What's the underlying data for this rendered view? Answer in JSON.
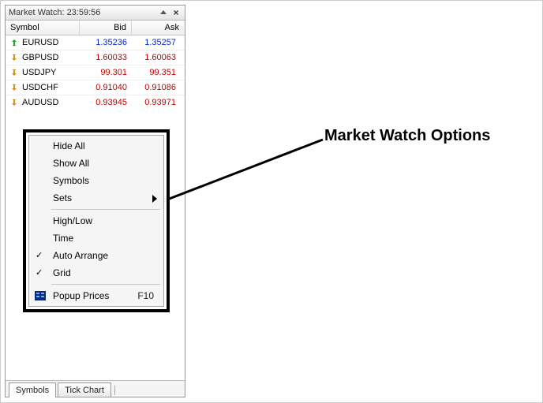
{
  "window": {
    "title_prefix": "Market Watch:",
    "time": "23:59:56"
  },
  "columns": {
    "symbol": "Symbol",
    "bid": "Bid",
    "ask": "Ask"
  },
  "rows": [
    {
      "dir": "up",
      "symbol": "EURUSD",
      "bid": "1.35236",
      "ask": "1.35257",
      "cls": "up"
    },
    {
      "dir": "down",
      "symbol": "GBPUSD",
      "bid": "1.60033",
      "ask": "1.60063",
      "cls": "down"
    },
    {
      "dir": "down",
      "symbol": "USDJPY",
      "bid": "99.301",
      "ask": "99.351",
      "cls": "down"
    },
    {
      "dir": "down",
      "symbol": "USDCHF",
      "bid": "0.91040",
      "ask": "0.91086",
      "cls": "down"
    },
    {
      "dir": "down",
      "symbol": "AUDUSD",
      "bid": "0.93945",
      "ask": "0.93971",
      "cls": "down"
    }
  ],
  "tabs": {
    "symbols": "Symbols",
    "tick": "Tick Chart"
  },
  "menu": {
    "hide_all": "Hide All",
    "show_all": "Show All",
    "symbols": "Symbols",
    "sets": "Sets",
    "high_low": "High/Low",
    "time": "Time",
    "auto_arrange": "Auto Arrange",
    "grid": "Grid",
    "popup_prices": "Popup Prices",
    "popup_accel": "F10"
  },
  "annotation": {
    "title": "Market Watch Options"
  }
}
